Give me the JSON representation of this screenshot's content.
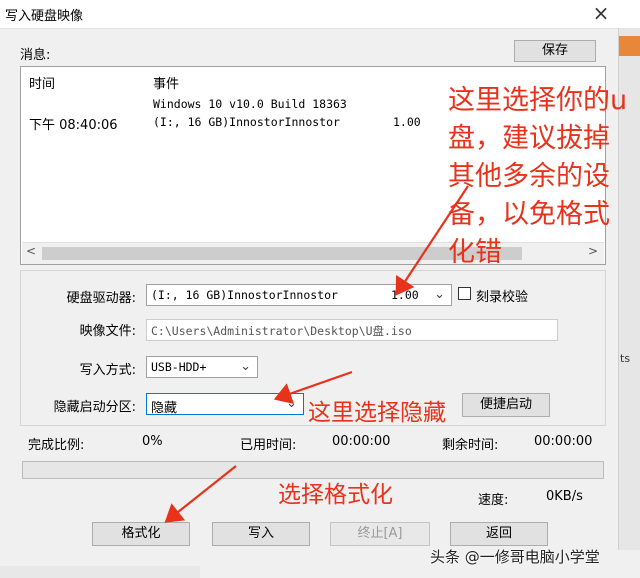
{
  "window": {
    "title": "写入硬盘映像",
    "close_glyph": "×"
  },
  "messages": {
    "label": "消息:",
    "save_label": "保存",
    "columns": {
      "time": "时间",
      "event": "事件"
    },
    "rows": [
      {
        "time": "",
        "event": "Windows 10 v10.0 Build 18363",
        "extra": ""
      },
      {
        "time": "下午 08:40:06",
        "event": "(I:, 16 GB)InnostorInnostor",
        "extra": "1.00"
      }
    ],
    "scroll_left": "<",
    "scroll_right": ">"
  },
  "form": {
    "drive_label": "硬盘驱动器:",
    "drive_value": "(I:, 16 GB)InnostorInnostor",
    "drive_size": "1.00",
    "verify_label": "刻录校验",
    "image_label": "映像文件:",
    "image_value": "C:\\Users\\Administrator\\Desktop\\U盘.iso",
    "write_label": "写入方式:",
    "write_value": "USB-HDD+",
    "hide_label": "隐藏启动分区:",
    "hide_value": "隐藏",
    "boot_label": "便捷启动",
    "arrow_glyph": "⌄"
  },
  "progress": {
    "done_label": "完成比例:",
    "done_value": "0%",
    "done_fraction": 0,
    "used_label": "已用时间:",
    "used_value": "00:00:00",
    "remain_label": "剩余时间:",
    "remain_value": "00:00:00",
    "speed_label": "速度:",
    "speed_value": "0KB/s"
  },
  "buttons": {
    "format": "格式化",
    "write": "写入",
    "stop": "终止[A]",
    "back": "返回"
  },
  "annotations": {
    "select_drive": "这里选择你的u盘，建议拔掉其他多余的设备，以免格式化错",
    "select_hide": "这里选择隐藏",
    "select_format": "选择格式化"
  },
  "background": {
    "strip_text": "ts"
  },
  "watermark": "头条 @一修哥电脑小学堂",
  "colors": {
    "annotation": "#e8321c",
    "progress": "#06b025",
    "focus": "#0078d7"
  }
}
